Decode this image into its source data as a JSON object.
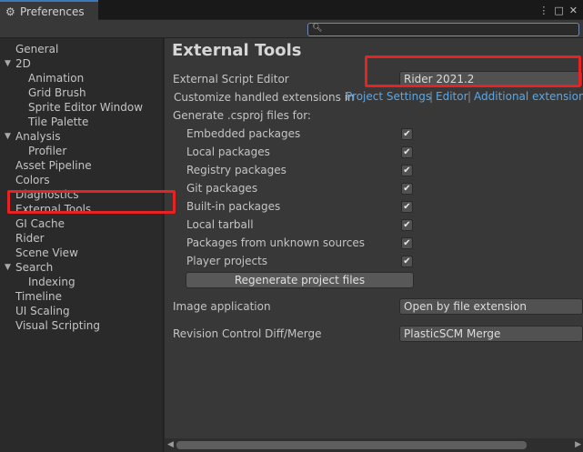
{
  "window": {
    "tab_title": "Preferences",
    "controls": {
      "menu": "⋮",
      "maximize": "□",
      "close": "✕"
    }
  },
  "search": {
    "placeholder": "",
    "icon": "search-icon"
  },
  "sidebar": {
    "items": [
      {
        "label": "General",
        "indent": 0
      },
      {
        "label": "2D",
        "indent": 0,
        "foldout": "expanded"
      },
      {
        "label": "Animation",
        "indent": 1
      },
      {
        "label": "Grid Brush",
        "indent": 1
      },
      {
        "label": "Sprite Editor Window",
        "indent": 1
      },
      {
        "label": "Tile Palette",
        "indent": 1
      },
      {
        "label": "Analysis",
        "indent": 0,
        "foldout": "expanded"
      },
      {
        "label": "Profiler",
        "indent": 1
      },
      {
        "label": "Asset Pipeline",
        "indent": 0
      },
      {
        "label": "Colors",
        "indent": 0
      },
      {
        "label": "Diagnostics",
        "indent": 0
      },
      {
        "label": "External Tools",
        "indent": 0,
        "selected": true
      },
      {
        "label": "GI Cache",
        "indent": 0
      },
      {
        "label": "Rider",
        "indent": 0
      },
      {
        "label": "Scene View",
        "indent": 0
      },
      {
        "label": "Search",
        "indent": 0,
        "foldout": "expanded"
      },
      {
        "label": "Indexing",
        "indent": 1
      },
      {
        "label": "Timeline",
        "indent": 0
      },
      {
        "label": "UI Scaling",
        "indent": 0
      },
      {
        "label": "Visual Scripting",
        "indent": 0
      }
    ]
  },
  "main": {
    "title": "External Tools",
    "script_editor": {
      "label": "External Script Editor",
      "value": "Rider 2021.2"
    },
    "extensions": {
      "label": "Customize handled extensions in",
      "links": [
        "Project Settings",
        "Editor",
        "Additional extensions"
      ],
      "separator": "|"
    },
    "csproj": {
      "label": "Generate .csproj files for:",
      "options": [
        {
          "label": "Embedded packages",
          "checked": true
        },
        {
          "label": "Local packages",
          "checked": true
        },
        {
          "label": "Registry packages",
          "checked": true
        },
        {
          "label": "Git packages",
          "checked": true
        },
        {
          "label": "Built-in packages",
          "checked": true
        },
        {
          "label": "Local tarball",
          "checked": true
        },
        {
          "label": "Packages from unknown sources",
          "checked": true
        },
        {
          "label": "Player projects",
          "checked": true
        }
      ],
      "check_glyph": "✔",
      "regenerate_label": "Regenerate project files"
    },
    "image_application": {
      "label": "Image application",
      "value": "Open by file extension"
    },
    "revision_control": {
      "label": "Revision Control Diff/Merge",
      "value": "PlasticSCM Merge"
    }
  },
  "colors": {
    "accent_link": "#5aa7ea",
    "highlight_box": "#e62222",
    "panel_bg": "#383838",
    "sidebar_bg": "#2a2a2a"
  }
}
